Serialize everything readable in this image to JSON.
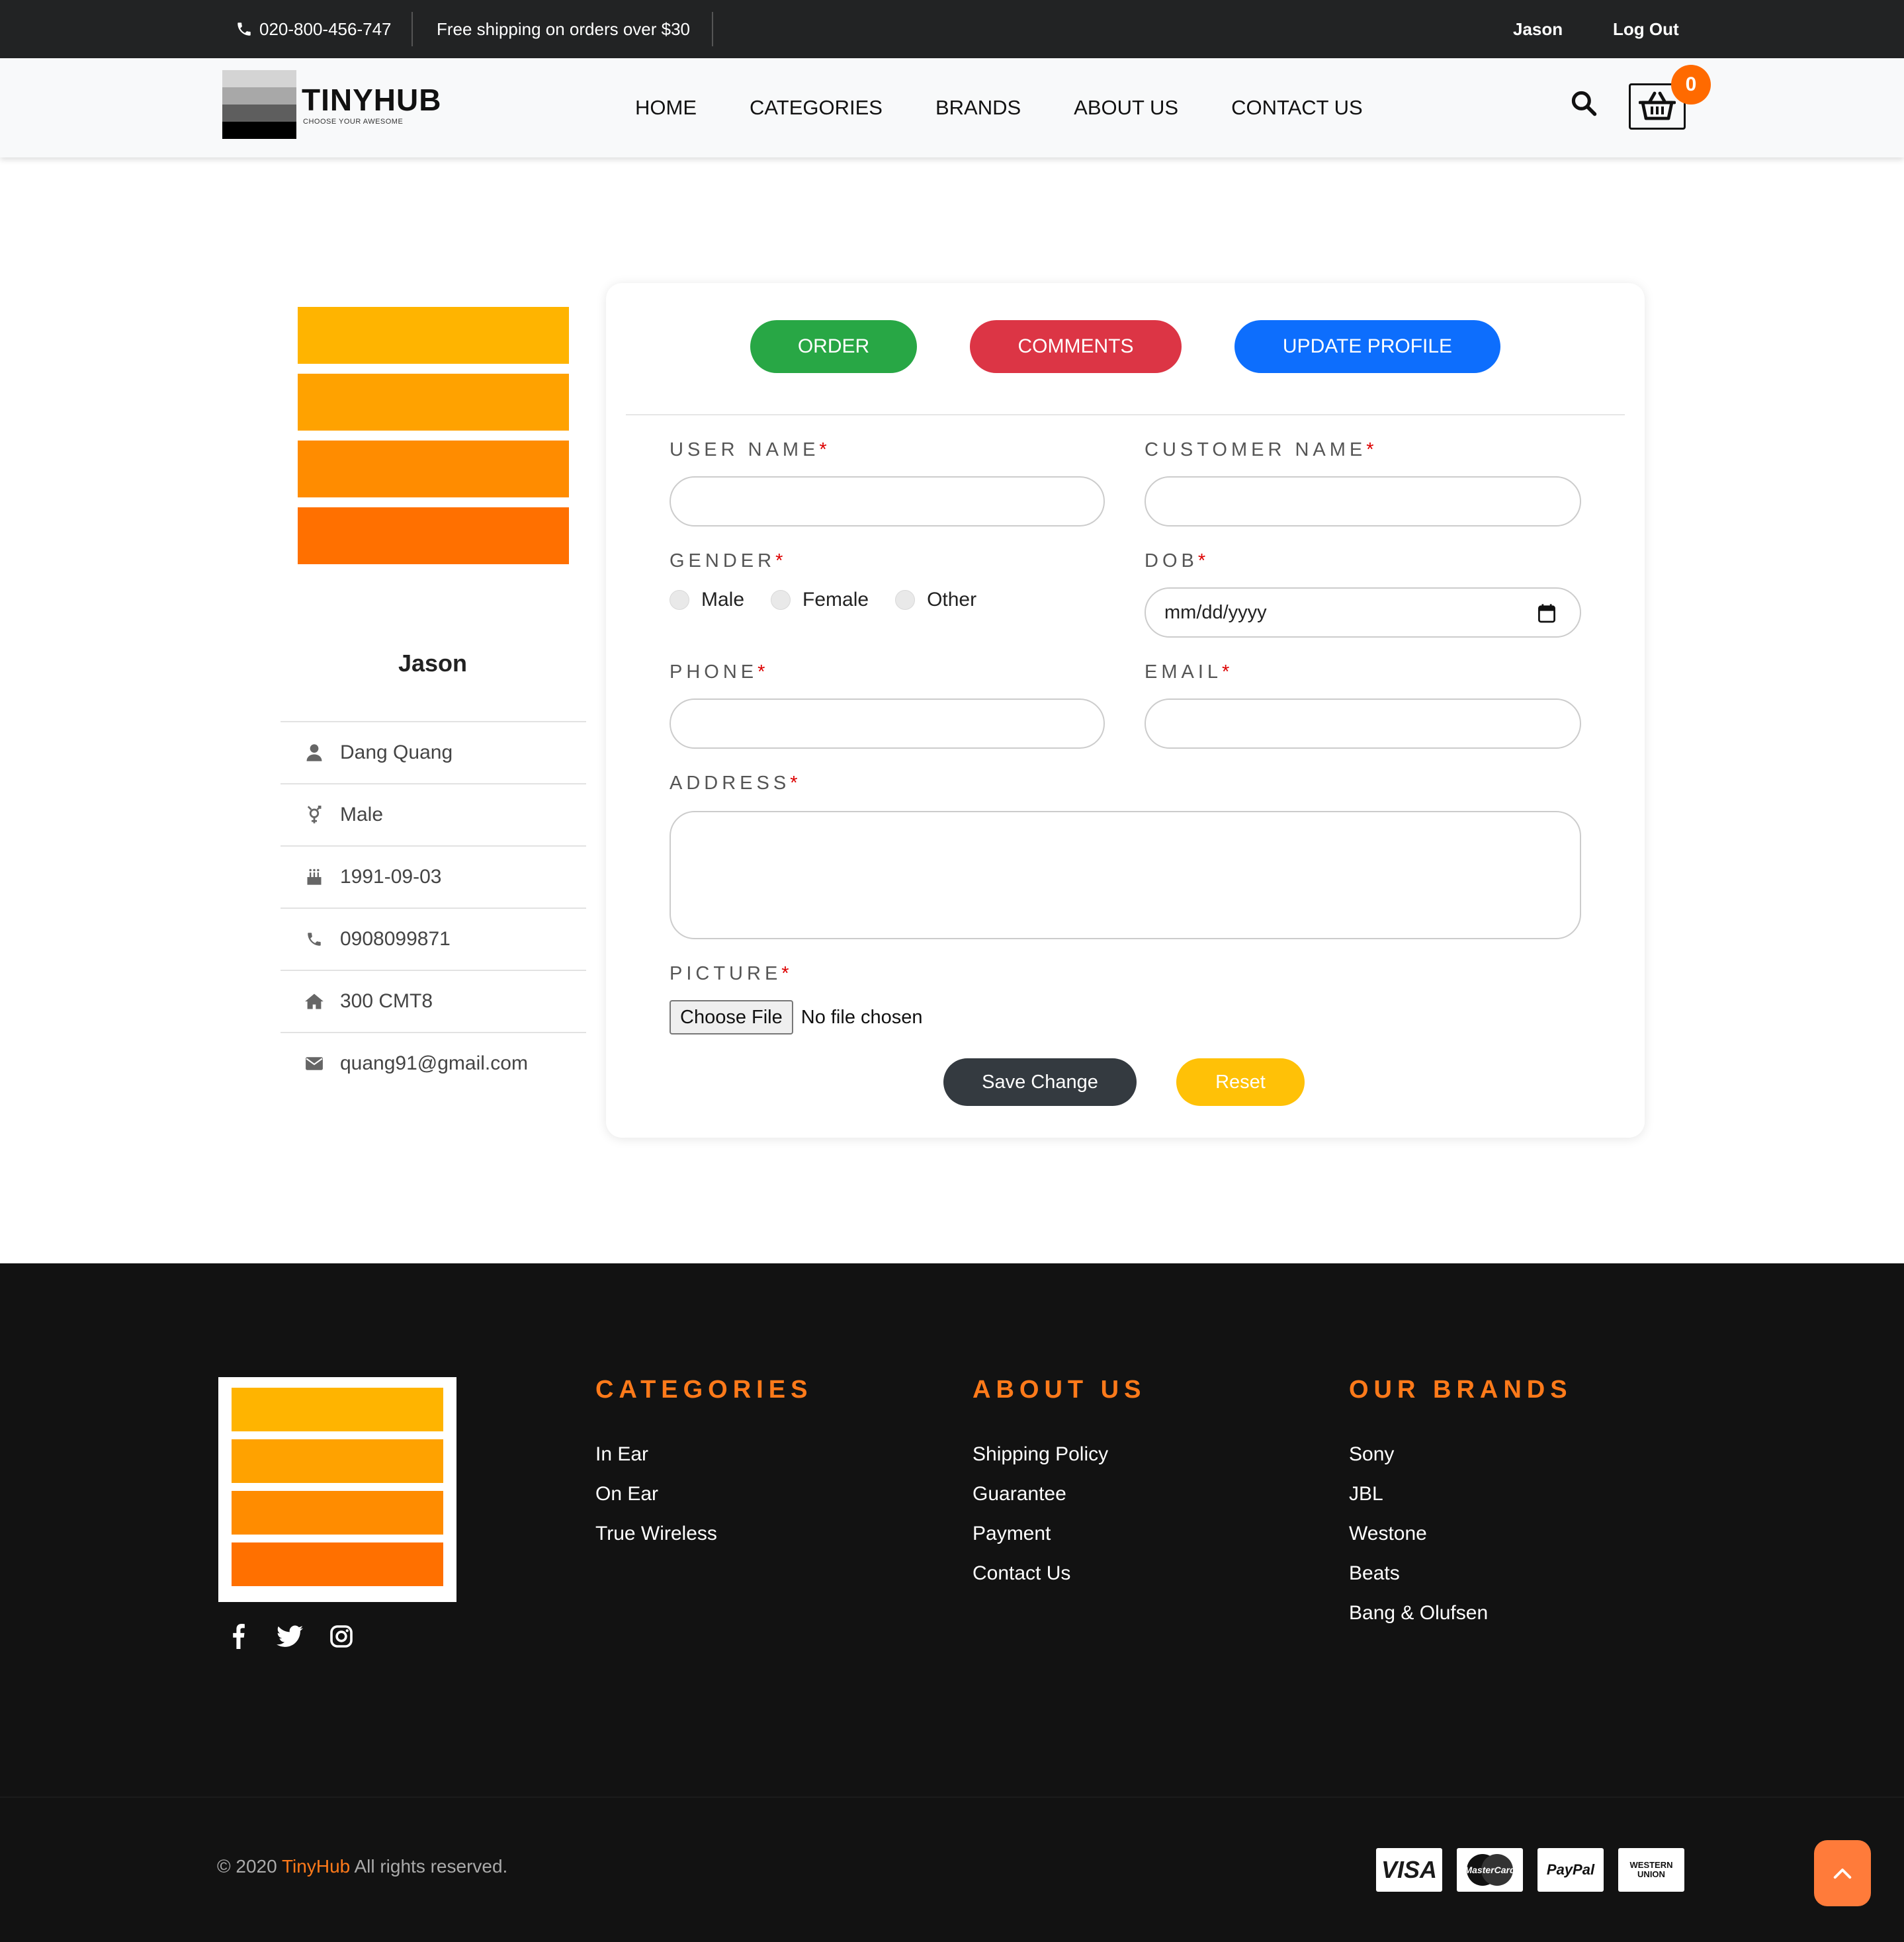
{
  "topbar": {
    "phone": "020-800-456-747",
    "shipping": "Free shipping on orders over $30",
    "user": "Jason",
    "logout": "Log Out"
  },
  "header": {
    "brand": "TINYHUB",
    "tagline": "CHOOSE YOUR AWESOME",
    "nav": [
      "HOME",
      "CATEGORIES",
      "BRANDS",
      "ABOUT US",
      "CONTACT US"
    ],
    "cart_count": "0"
  },
  "profile": {
    "name": "Jason",
    "customer_name": "Dang Quang",
    "gender": "Male",
    "dob": "1991-09-03",
    "phone": "0908099871",
    "address": "300 CMT8",
    "email": "quang91@gmail.com"
  },
  "tabs": {
    "order": "ORDER",
    "comments": "COMMENTS",
    "update_profile": "UPDATE PROFILE"
  },
  "form": {
    "user_name_label": "USER NAME",
    "customer_name_label": "CUSTOMER NAME",
    "gender_label": "GENDER",
    "gender_options": [
      "Male",
      "Female",
      "Other"
    ],
    "dob_label": "DOB",
    "dob_placeholder": "mm/dd/yyyy",
    "phone_label": "PHONE",
    "email_label": "EMAIL",
    "address_label": "ADDRESS",
    "picture_label": "PICTURE",
    "choose_file": "Choose File",
    "no_file": "No file chosen",
    "save": "Save Change",
    "reset": "Reset",
    "required_mark": "*"
  },
  "footer": {
    "categories_title": "CATEGORIES",
    "categories": [
      "In Ear",
      "On Ear",
      "True Wireless"
    ],
    "about_title": "ABOUT US",
    "about": [
      "Shipping Policy",
      "Guarantee",
      "Payment",
      "Contact Us"
    ],
    "brands_title": "OUR BRANDS",
    "brands": [
      "Sony",
      "JBL",
      "Westone",
      "Beats",
      "Bang & Olufsen"
    ],
    "copyright_prefix": "© 2020",
    "copyright_brand": "TinyHub",
    "copyright_suffix": "All rights reserved.",
    "payments": [
      "VISA",
      "MasterCard",
      "PayPal",
      "WESTERN UNION"
    ]
  },
  "colors": {
    "order": "#28a745",
    "comments": "#dc3545",
    "update": "#0d6efd",
    "accent": "#ff7a1a",
    "logo_bars": [
      "#ffb400",
      "#ffa200",
      "#ff8c00",
      "#ff7000"
    ]
  }
}
